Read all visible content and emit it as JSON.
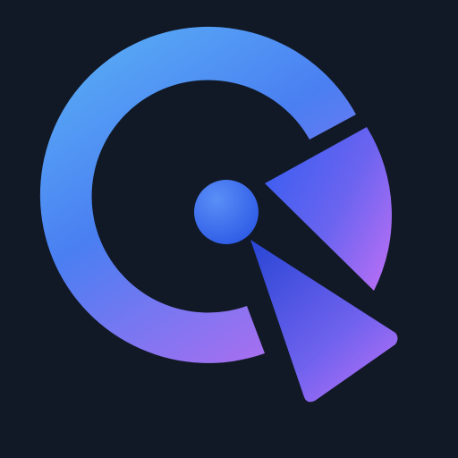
{
  "icon": {
    "name": "app-logo-icon",
    "description_shape": "ring-with-sector-and-pointer"
  },
  "colors": {
    "background": "#111826",
    "ring_blue": "#4a7ff2",
    "ring_light_blue": "#57a8f5",
    "ring_purple": "#a56ff0",
    "sector_blue": "#3b5ef0",
    "sector_purple": "#a86cf2",
    "pointer_blue": "#2f4fd9",
    "pointer_purple": "#b06cf5",
    "dot_blue": "#3b6af2",
    "dot_light": "#5a8ff7"
  }
}
